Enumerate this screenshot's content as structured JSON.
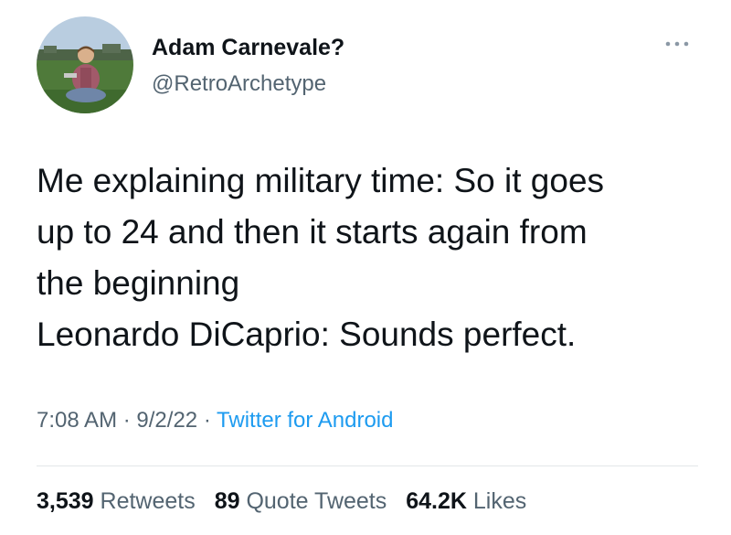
{
  "author": {
    "display_name": "Adam Carnevale?",
    "handle": "@RetroArchetype",
    "avatar_icon": "profile-photo"
  },
  "more_icon": "more-options-icon",
  "tweet": {
    "lines": [
      "Me explaining military time: So it goes",
      "up to 24 and then it starts again from",
      "the beginning",
      "Leonardo DiCaprio: Sounds perfect."
    ]
  },
  "meta": {
    "time": "7:08 AM",
    "separator": "·",
    "date": "9/2/22",
    "source": "Twitter for Android"
  },
  "stats": {
    "retweets": {
      "count": "3,539",
      "label": "Retweets"
    },
    "quotes": {
      "count": "89",
      "label": "Quote Tweets"
    },
    "likes": {
      "count": "64.2K",
      "label": "Likes"
    }
  },
  "colors": {
    "text_primary": "#0f1419",
    "text_secondary": "#536471",
    "link": "#1d9bf0",
    "divider": "#e3e6e9"
  }
}
